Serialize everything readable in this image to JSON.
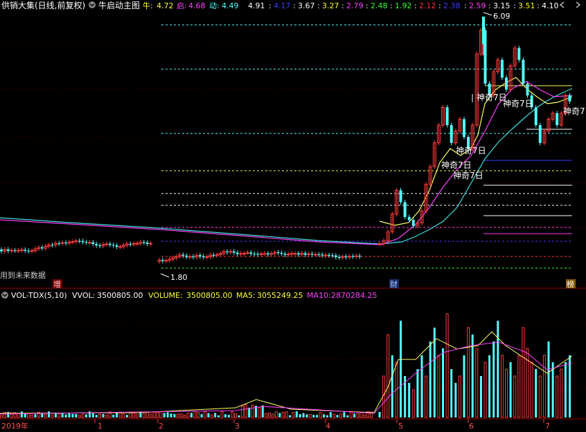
{
  "main_header": {
    "title": "供销大集(日线,前复权)",
    "indicator_name": "牛启动主图",
    "label_niu": "牛:",
    "val_niu": "4.72",
    "label_qi": "启:",
    "val_qi": "4.68",
    "label_dong": "动:",
    "val_dong": "4.49",
    "levels": [
      {
        "text": "4.91",
        "color": "#ffffff"
      },
      {
        "text": "4.17",
        "color": "#3c3cff"
      },
      {
        "text": "3.67",
        "color": "#ffffff"
      },
      {
        "text": "3.27",
        "color": "#ffff33"
      },
      {
        "text": "2.79",
        "color": "#ff40ff"
      },
      {
        "text": "2.48",
        "color": "#33ff33"
      },
      {
        "text": "1.92",
        "color": "#33ff33"
      },
      {
        "text": "2.12",
        "color": "#ff3333"
      },
      {
        "text": "2.38",
        "color": "#3c3cff"
      },
      {
        "text": "2.59",
        "color": "#ff40ff"
      },
      {
        "text": "3.15",
        "color": "#ffffff"
      },
      {
        "text": "3.51",
        "color": "#ffff33"
      },
      {
        "text": "4.10",
        "color": "#ffffff"
      }
    ]
  },
  "price_annotations": {
    "high": "6.09",
    "low": "1.80",
    "future_data": "用到未来数据",
    "shenqi": [
      "神奇7日",
      "神奇7日",
      "神奇7日",
      "神奇7日",
      "神奇7日",
      "神奇7"
    ]
  },
  "event_markers": [
    "增",
    "财",
    "榜"
  ],
  "volume_header": {
    "name": "VOL-TDX(5,10)",
    "vvol_label": "VVOL:",
    "vvol": "3500805.00",
    "volume_label": "VOLUME:",
    "volume": "3500805.00",
    "ma5_label": "MA5:",
    "ma5": "3055249.25",
    "ma10_label": "MA10:",
    "ma10": "2870284.25"
  },
  "x_axis": {
    "labels": [
      "2019年",
      "1",
      "2",
      "3",
      "4",
      "5",
      "6",
      "7"
    ]
  },
  "colors": {
    "up": "#ff3c3c",
    "down": "#54ffff",
    "ma_yellow": "#ffff66",
    "ma_magenta": "#ff40ff",
    "ma_cyan": "#40e0e0",
    "grid_red": "#7a0000"
  },
  "icons": [
    "chevron-down-icon",
    "chevron-left-icon",
    "chevron-right-icon"
  ]
}
